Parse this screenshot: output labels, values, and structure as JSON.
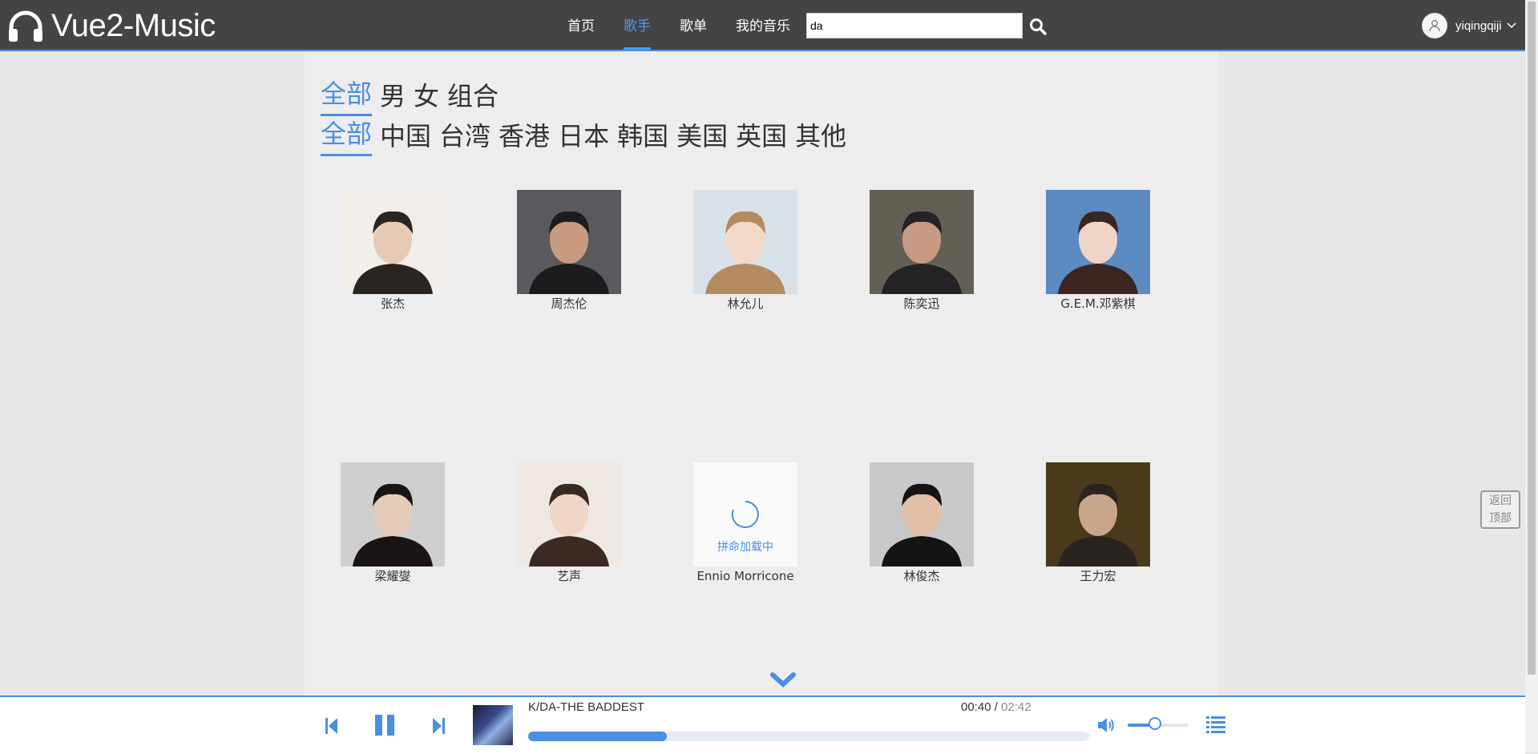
{
  "header": {
    "logo_text": "Vue2-Music",
    "nav": [
      {
        "label": "首页",
        "active": false
      },
      {
        "label": "歌手",
        "active": true
      },
      {
        "label": "歌单",
        "active": false
      },
      {
        "label": "我的音乐",
        "active": false
      }
    ],
    "search_value": "da",
    "username": "yiqingqiji"
  },
  "filters": {
    "gender": [
      "全部",
      "男",
      "女",
      "组合"
    ],
    "region": [
      "全部",
      "中国",
      "台湾",
      "香港",
      "日本",
      "韩国",
      "美国",
      "英国",
      "其他"
    ]
  },
  "singers": [
    {
      "name": "张杰"
    },
    {
      "name": "周杰伦"
    },
    {
      "name": "林允儿"
    },
    {
      "name": "陈奕迅"
    },
    {
      "name": "G.E.M.邓紫棋"
    },
    {
      "name": "梁耀燮"
    },
    {
      "name": "艺声"
    },
    {
      "name": "Ennio Morricone"
    },
    {
      "name": "林俊杰"
    },
    {
      "name": "王力宏"
    }
  ],
  "loading_text": "拼命加载中",
  "back_to_top": {
    "line1": "返回",
    "line2": "顶部"
  },
  "player": {
    "track_title": "K/DA-THE BADDEST",
    "current_time": "00:40",
    "separator": " / ",
    "total_time": "02:42",
    "progress_fraction": 0.247,
    "volume_fraction": 0.45
  },
  "colors": {
    "accent": "#4a8fe0",
    "header_bg": "#444445"
  }
}
